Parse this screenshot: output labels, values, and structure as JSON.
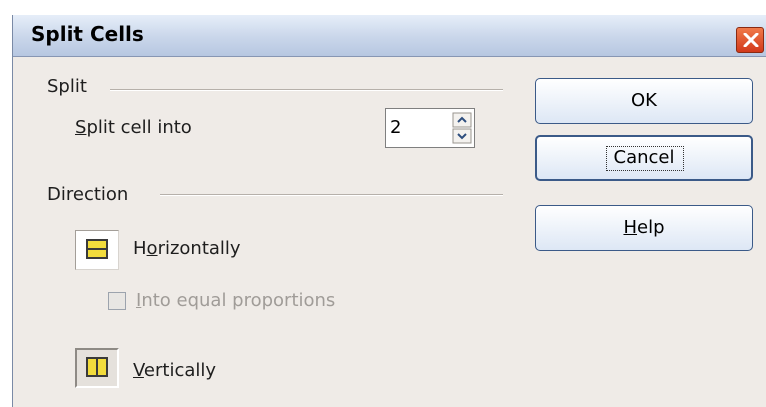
{
  "window": {
    "title": "Split Cells"
  },
  "split": {
    "section_label": "Split",
    "into_label_pre": "",
    "into_label_mnemonic": "S",
    "into_label_post": "plit cell into",
    "value": "2"
  },
  "direction": {
    "section_label": "Direction",
    "horizontal_pre": "H",
    "horizontal_mnemonic": "o",
    "horizontal_post": "rizontally",
    "equal_mnemonic": "I",
    "equal_post": "nto equal proportions",
    "vertical_mnemonic": "V",
    "vertical_post": "ertically"
  },
  "buttons": {
    "ok": "OK",
    "cancel": "Cancel",
    "help_mnemonic": "H",
    "help_post": "elp"
  },
  "colors": {
    "icon_fill": "#f2dc3c",
    "icon_stroke": "#3a3a3a"
  }
}
